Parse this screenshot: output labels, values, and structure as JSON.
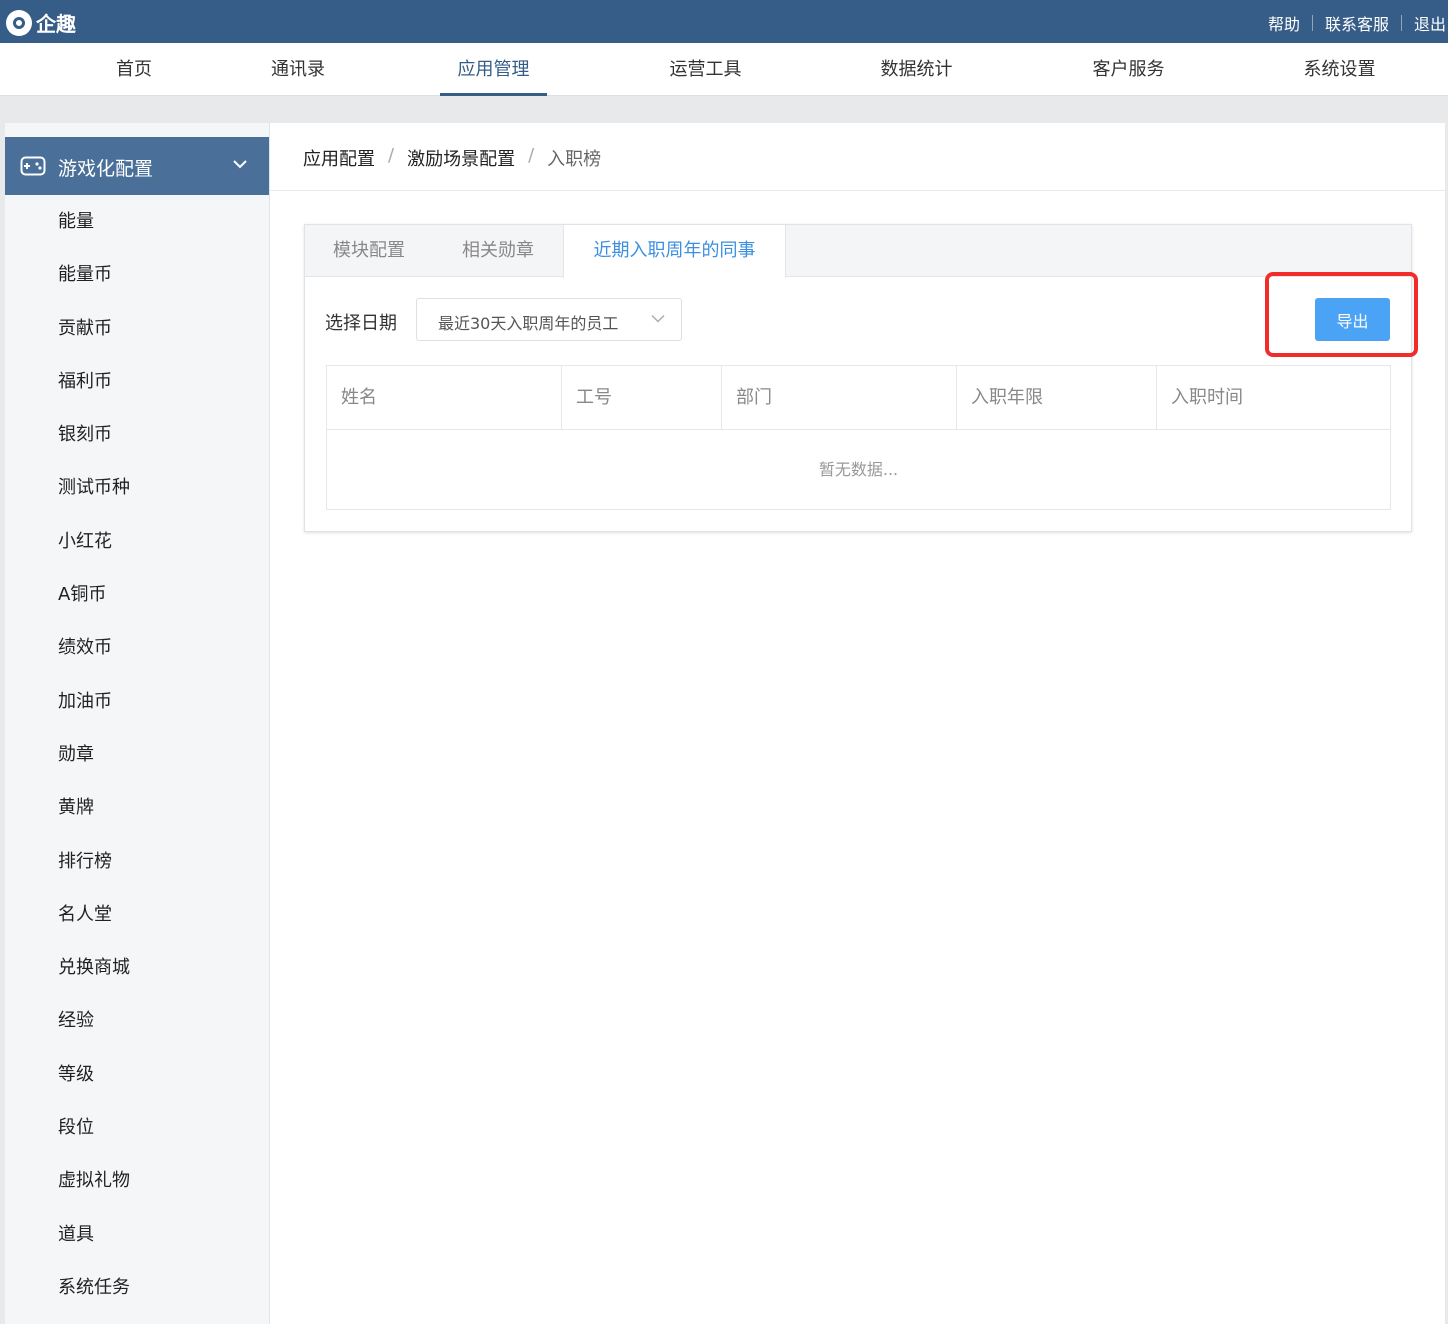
{
  "header": {
    "logo_text": "企趣",
    "links": [
      "帮助",
      "联系客服",
      "退出"
    ]
  },
  "nav": {
    "items": [
      "首页",
      "通讯录",
      "应用管理",
      "运营工具",
      "数据统计",
      "客户服务",
      "系统设置"
    ],
    "active_index": 2
  },
  "sidebar": {
    "section_title": "游戏化配置",
    "items": [
      "能量",
      "能量币",
      "贡献币",
      "福利币",
      "银刻币",
      "测试币种",
      "小红花",
      "A铜币",
      "绩效币",
      "加油币",
      "勋章",
      "黄牌",
      "排行榜",
      "名人堂",
      "兑换商城",
      "经验",
      "等级",
      "段位",
      "虚拟礼物",
      "道具",
      "系统任务"
    ]
  },
  "breadcrumb": {
    "items": [
      "应用配置",
      "激励场景配置",
      "入职榜"
    ],
    "separator": "/"
  },
  "tabs": {
    "items": [
      "模块配置",
      "相关勋章",
      "近期入职周年的同事"
    ],
    "active_index": 2
  },
  "filter": {
    "label": "选择日期",
    "selected": "最近30天入职周年的员工"
  },
  "toolbar": {
    "export_label": "导出"
  },
  "table": {
    "columns": [
      "姓名",
      "工号",
      "部门",
      "入职年限",
      "入职时间"
    ],
    "empty_text": "暂无数据..."
  },
  "colors": {
    "header_bg": "#365c88",
    "sidebar_active_bg": "#4a6f98",
    "accent_blue": "#3d8fe0",
    "button_blue": "#4aa3f5",
    "highlight_red": "#f22b2b"
  }
}
